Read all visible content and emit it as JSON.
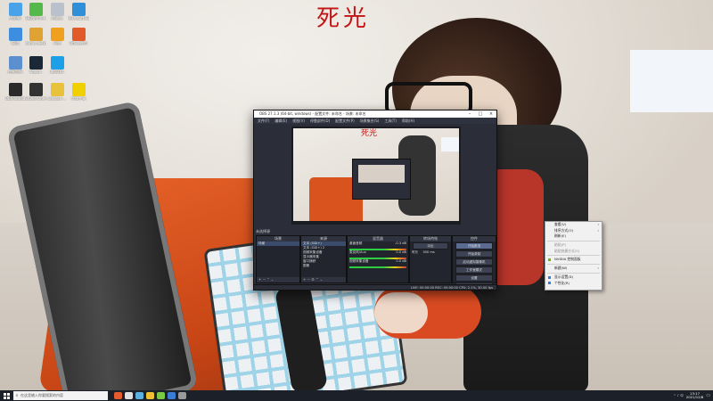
{
  "wallpaper_title": "死光",
  "desktop_icons": [
    {
      "label": "此电脑",
      "color": "#4aa3e8"
    },
    {
      "label": "360安全卫士",
      "color": "#55b84a"
    },
    {
      "label": "回收站",
      "color": "#b9c2cc"
    },
    {
      "label": "Microsoft Edge",
      "color": "#2f8fd8"
    },
    {
      "label": "网络",
      "color": "#3d8ee0"
    },
    {
      "label": "dnmp_desktop",
      "color": "#e0a233"
    },
    {
      "label": "迅雷",
      "color": "#f0a020"
    },
    {
      "label": "Office应用",
      "color": "#e05a2a"
    },
    {
      "label": "控制面板",
      "color": "#5b8fd0"
    },
    {
      "label": "Steam",
      "color": "#1b2838"
    },
    {
      "label": "腾讯QQ",
      "color": "#1ea0e8"
    },
    {
      "label": "",
      "color": "#00000000"
    },
    {
      "label": "OBS Studio",
      "color": "#2a2a2a"
    },
    {
      "label": "Studio One 5",
      "color": "#333333"
    },
    {
      "label": "proseco-...",
      "color": "#e8c23a"
    },
    {
      "label": "字体工具",
      "color": "#f0d000"
    }
  ],
  "obs": {
    "title": "OBS 27.1.3 (64-bit, windows) - 配置文件: 未命名 - 场景: 未命名",
    "menu": [
      "文件(F)",
      "编辑(E)",
      "视图(V)",
      "停靠部件(D)",
      "配置文件(P)",
      "场景集合(S)",
      "工具(T)",
      "帮助(H)"
    ],
    "preview_title": "死光",
    "scene_label": "未选择源",
    "docks": {
      "scenes": {
        "header": "场景",
        "items": [
          "场景"
        ]
      },
      "sources": {
        "header": "来源",
        "items": [
          "文本 (GDI+)",
          "文本 (GDI+) 2",
          "视频采集设备",
          "显示器采集",
          "窗口捕获",
          "图像"
        ]
      },
      "mixer": {
        "header": "混音器",
        "items": [
          {
            "name": "桌面音频",
            "db": "-0.3 dB"
          },
          {
            "name": "麦克风/Aux",
            "db": "0.0 dB"
          },
          {
            "name": "视频采集设备",
            "db": "0.0 dB"
          }
        ]
      },
      "transitions": {
        "header": "转场特效",
        "items": [
          "淡出",
          "时长",
          "300 ms"
        ]
      },
      "controls": {
        "header": "控件",
        "buttons": [
          "开始推流",
          "开始录制",
          "启动虚拟摄像机",
          "工作室模式",
          "设置",
          "退出"
        ]
      }
    },
    "status": "LIVE: 00:00:00  REC: 00:00:00  CPU: 2.1%, 30.00 fps"
  },
  "context_menu": {
    "items": [
      {
        "label": "查看(V)",
        "arrow": true,
        "dim": false
      },
      {
        "label": "排序方式(O)",
        "arrow": true,
        "dim": false
      },
      {
        "label": "刷新(E)",
        "arrow": false,
        "dim": false
      },
      {
        "sep": true
      },
      {
        "label": "粘贴(P)",
        "arrow": false,
        "dim": true
      },
      {
        "label": "粘贴快捷方式(S)",
        "arrow": false,
        "dim": true
      },
      {
        "sep": true
      },
      {
        "label": "NVIDIA 控制面板",
        "arrow": false,
        "dim": false,
        "icon": "#76b900"
      },
      {
        "sep": true
      },
      {
        "label": "新建(W)",
        "arrow": true,
        "dim": false
      },
      {
        "sep": true
      },
      {
        "label": "显示设置(D)",
        "arrow": false,
        "dim": false,
        "icon": "#3a7bd5"
      },
      {
        "label": "个性化(R)",
        "arrow": false,
        "dim": false,
        "icon": "#3a7bd5"
      }
    ]
  },
  "taskbar": {
    "search_placeholder": "在这里输入你要搜索的内容",
    "apps": [
      "#e55b2b",
      "#e0e0e0",
      "#5ab0e0",
      "#f0c030",
      "#7ac943",
      "#3a7bd5",
      "#9a9a9a"
    ],
    "tray_text": "^  ♪  中",
    "time": "13:17",
    "date": "2021/12/8"
  }
}
